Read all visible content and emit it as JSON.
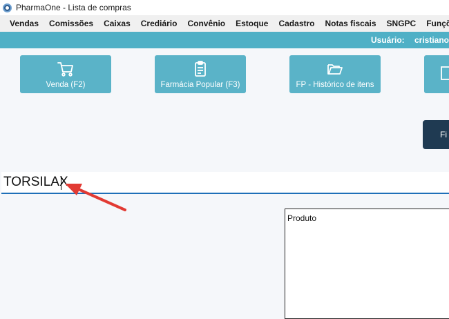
{
  "window": {
    "title": "PharmaOne - Lista de compras"
  },
  "menu": [
    {
      "id": "vendas",
      "label": "Vendas"
    },
    {
      "id": "comissoes",
      "label": "Comissões"
    },
    {
      "id": "caixas",
      "label": "Caixas"
    },
    {
      "id": "crediario",
      "label": "Crediário"
    },
    {
      "id": "convenio",
      "label": "Convênio"
    },
    {
      "id": "estoque",
      "label": "Estoque"
    },
    {
      "id": "cadastro",
      "label": "Cadastro"
    },
    {
      "id": "notas-fiscais",
      "label": "Notas fiscais"
    },
    {
      "id": "sngpc",
      "label": "SNGPC"
    },
    {
      "id": "funcoes",
      "label": "Funções a"
    }
  ],
  "userbar": {
    "label": "Usuário:",
    "name": "cristiano"
  },
  "actions": [
    {
      "label": "Venda (F2)",
      "icon": "cart-icon"
    },
    {
      "label": "Farmácia Popular (F3)",
      "icon": "clipboard-icon"
    },
    {
      "label": "FP - Histórico de itens",
      "icon": "folder-open-icon"
    },
    {
      "label": "",
      "icon": "partial-icon"
    }
  ],
  "dark_button": {
    "label": "Fi"
  },
  "search": {
    "value": "TORSILAX"
  },
  "table": {
    "header": "Produto"
  },
  "colors": {
    "accent": "#4fb0c6",
    "button": "#5ab3c8",
    "dark_button": "#1f3a52",
    "arrow": "#e23a33",
    "underline": "#1e6fb8"
  }
}
